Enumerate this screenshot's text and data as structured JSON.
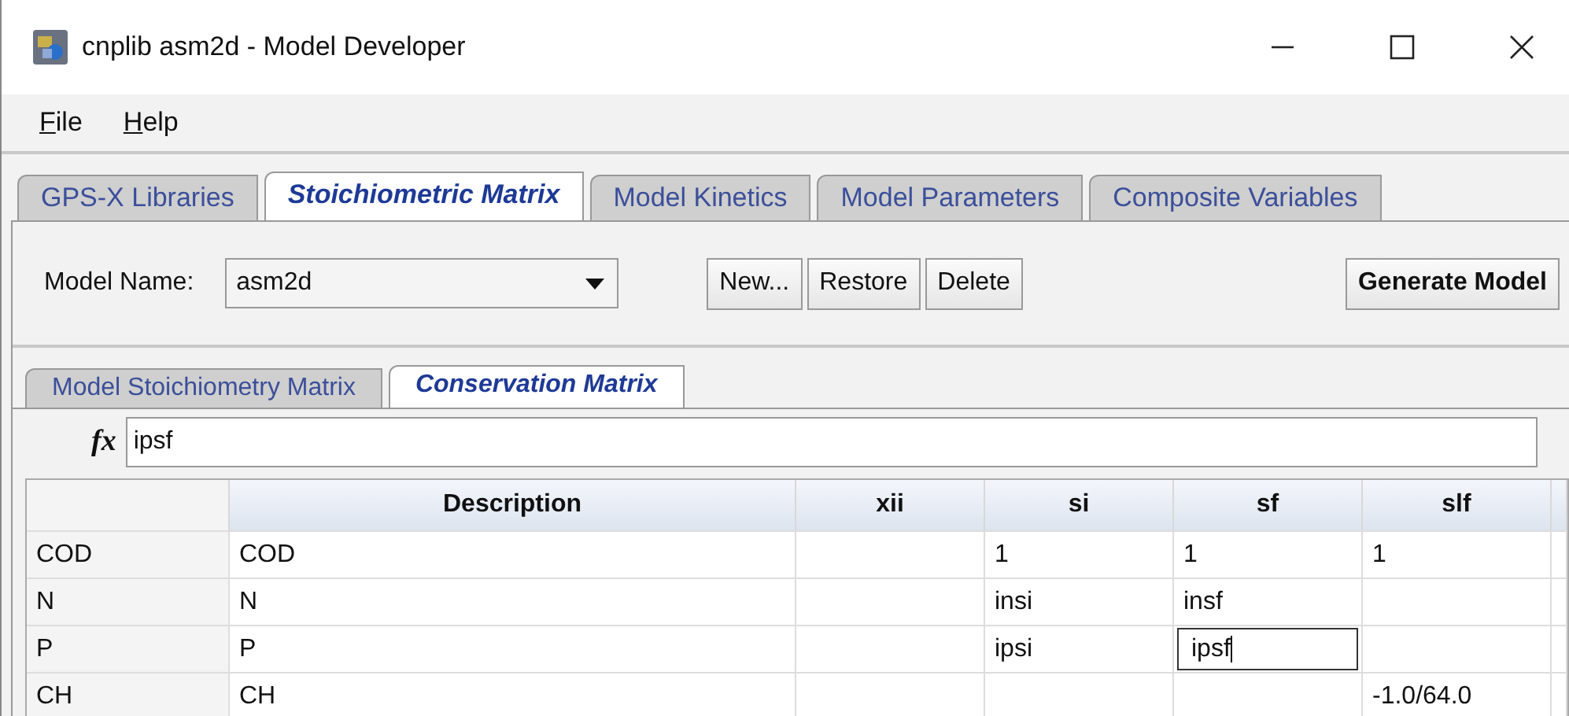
{
  "window": {
    "title": "cnplib asm2d - Model Developer"
  },
  "menu": [
    {
      "label": "File"
    },
    {
      "label": "Help"
    }
  ],
  "tabs": [
    {
      "label": "GPS-X Libraries",
      "selected": false
    },
    {
      "label": "Stoichiometric Matrix",
      "selected": true
    },
    {
      "label": "Model Kinetics",
      "selected": false
    },
    {
      "label": "Model Parameters",
      "selected": false
    },
    {
      "label": "Composite Variables",
      "selected": false
    }
  ],
  "model_name": {
    "label": "Model Name:",
    "value": "asm2d"
  },
  "buttons": [
    "New...",
    "Restore",
    "Delete"
  ],
  "generate_button": "Generate Model",
  "sub_tabs": [
    {
      "label": "Model Stoichiometry Matrix",
      "selected": false
    },
    {
      "label": "Conservation Matrix",
      "selected": true
    }
  ],
  "formula": {
    "label": "fx",
    "value": "ipsf"
  },
  "table": {
    "columns": [
      "",
      "Description",
      "xii",
      "si",
      "sf",
      "slf"
    ],
    "rows": [
      {
        "cells": [
          {
            "text": "COD",
            "selected": false
          },
          {
            "text": "COD",
            "selected": false
          },
          {
            "text": "",
            "selected": false
          },
          {
            "text": "1",
            "selected": false
          },
          {
            "text": "1",
            "selected": false
          },
          {
            "text": "1",
            "selected": false
          }
        ]
      },
      {
        "cells": [
          {
            "text": "N",
            "selected": false
          },
          {
            "text": "N",
            "selected": false
          },
          {
            "text": "",
            "selected": false
          },
          {
            "text": "insi",
            "selected": false
          },
          {
            "text": "insf",
            "selected": false
          },
          {
            "text": "",
            "selected": false
          }
        ]
      },
      {
        "cells": [
          {
            "text": "P",
            "selected": false
          },
          {
            "text": "P",
            "selected": false
          },
          {
            "text": "",
            "selected": false
          },
          {
            "text": "ipsi",
            "selected": false
          },
          {
            "text": "ipsf",
            "selected": true
          },
          {
            "text": "",
            "selected": false
          }
        ]
      },
      {
        "cells": [
          {
            "text": "CH",
            "selected": false
          },
          {
            "text": "CH",
            "selected": false
          },
          {
            "text": "",
            "selected": false
          },
          {
            "text": "",
            "selected": false
          },
          {
            "text": "",
            "selected": false
          },
          {
            "text": "-1.0/64.0",
            "selected": false
          }
        ]
      }
    ]
  }
}
